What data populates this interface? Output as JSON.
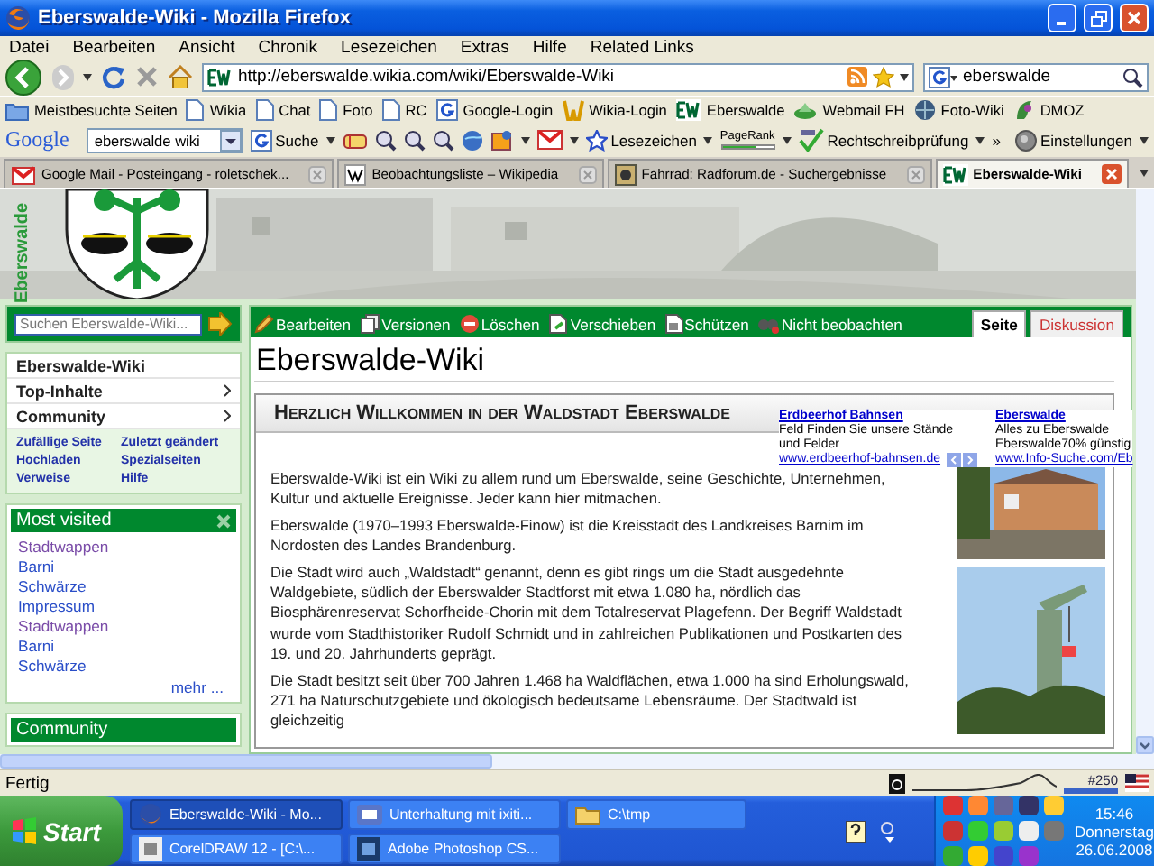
{
  "window": {
    "title": "Eberswalde-Wiki - Mozilla Firefox"
  },
  "menu": [
    "Datei",
    "Bearbeiten",
    "Ansicht",
    "Chronik",
    "Lesezeichen",
    "Extras",
    "Hilfe",
    "Related Links"
  ],
  "navigation": {
    "url": "http://eberswalde.wikia.com/wiki/Eberswalde-Wiki",
    "search": "eberswalde"
  },
  "bookmarks": [
    {
      "label": "Meistbesuchte Seiten",
      "kind": "folder"
    },
    {
      "label": "Wikia",
      "kind": "page"
    },
    {
      "label": "Chat",
      "kind": "page"
    },
    {
      "label": "Foto",
      "kind": "page"
    },
    {
      "label": "RC",
      "kind": "page"
    },
    {
      "label": "Google-Login",
      "kind": "google"
    },
    {
      "label": "Wikia-Login",
      "kind": "wikia"
    },
    {
      "label": "Eberswalde",
      "kind": "ew"
    },
    {
      "label": "Webmail FH",
      "kind": "mail"
    },
    {
      "label": "Foto-Wiki",
      "kind": "globe"
    },
    {
      "label": "DMOZ",
      "kind": "dmoz"
    }
  ],
  "google_toolbar": {
    "logo": "Google",
    "query": "eberswalde wiki",
    "search_button": "Suche",
    "bookmarks_button": "Lesezeichen",
    "pagerank": "PageRank",
    "spellcheck": "Rechtschreibprüfung",
    "more": "»",
    "settings": "Einstellungen"
  },
  "tabs": [
    {
      "label": "Google Mail - Posteingang - roletschek...",
      "kind": "gmail",
      "selected": false
    },
    {
      "label": "Beobachtungsliste – Wikipedia",
      "kind": "wikipedia",
      "selected": false
    },
    {
      "label": "Fahrrad: Radforum.de - Suchergebnisse",
      "kind": "forum",
      "selected": false
    },
    {
      "label": "Eberswalde-Wiki",
      "kind": "ew",
      "selected": true
    }
  ],
  "wiki": {
    "logo_text": "Eberswalde",
    "search": {
      "placeholder": "Suchen Eberswalde-Wiki..."
    },
    "nav": [
      {
        "label": "Eberswalde-Wiki",
        "expandable": false
      },
      {
        "label": "Top-Inhalte",
        "expandable": true
      },
      {
        "label": "Community",
        "expandable": true
      }
    ],
    "quick_links": [
      "Zufällige Seite",
      "Zuletzt geändert",
      "Hochladen",
      "Spezialseiten",
      "Verweise",
      "Hilfe"
    ],
    "most_visited": {
      "title": "Most visited",
      "items": [
        {
          "label": "Stadtwappen",
          "visited": true
        },
        {
          "label": "Barni",
          "visited": false
        },
        {
          "label": "Schwärze",
          "visited": false
        },
        {
          "label": "Impressum",
          "visited": false
        },
        {
          "label": "Stadtwappen",
          "visited": true
        },
        {
          "label": "Barni",
          "visited": false
        },
        {
          "label": "Schwärze",
          "visited": false
        }
      ],
      "more": "mehr ..."
    },
    "community_box": {
      "title": "Community"
    },
    "actions": [
      {
        "label": "Bearbeiten",
        "kind": "edit"
      },
      {
        "label": "Versionen",
        "kind": "history"
      },
      {
        "label": "Löschen",
        "kind": "delete"
      },
      {
        "label": "Verschieben",
        "kind": "move"
      },
      {
        "label": "Schützen",
        "kind": "protect"
      },
      {
        "label": "Nicht beobachten",
        "kind": "unwatch"
      }
    ],
    "page_tabs": [
      {
        "label": "Seite",
        "selected": true
      },
      {
        "label": "Diskussion",
        "selected": false
      }
    ],
    "title": "Eberswalde-Wiki",
    "welcome": {
      "heading": "Herzlich Willkommen in der Waldstadt Eberswalde",
      "paragraphs": [
        "Eberswalde-Wiki ist ein Wiki zu allem rund um Eberswalde, seine Geschichte, Unternehmen, Kultur und aktuelle Ereignisse. Jeder kann hier mitmachen.",
        "Eberswalde (1970–1993 Eberswalde-Finow) ist die Kreisstadt des Landkreises Barnim im Nordosten des Landes Brandenburg.",
        "Die Stadt wird auch „Waldstadt“ genannt, denn es gibt rings um die Stadt ausgedehnte Waldgebiete, südlich der Eberswalder Stadtforst mit etwa 1.080 ha, nördlich das Biosphärenreservat Schorfheide-Chorin mit dem Totalreservat Plagefenn. Der Begriff Waldstadt wurde vom Stadthistoriker Rudolf Schmidt und in zahlreichen Publikationen und Postkarten des 19. und 20. Jahrhunderts geprägt.",
        "Die Stadt besitzt seit über 700 Jahren 1.468 ha Waldflächen, etwa 1.000 ha sind Erholungswald, 271 ha Naturschutzgebiete und ökologisch bedeutsame Lebensräume. Der Stadtwald ist gleichzeitig"
      ]
    },
    "ads": [
      {
        "title": "Erdbeerhof Bahnsen",
        "lines": [
          "Feld Finden Sie unsere Stände",
          "und Felder"
        ],
        "url": "www.erdbeerhof-bahnsen.de"
      },
      {
        "title": "Eberswalde",
        "lines": [
          "Alles zu Eberswalde",
          "Eberswalde70% günstig"
        ],
        "url": "www.Info-Suche.com/Eb"
      }
    ]
  },
  "status_bar": {
    "text": "Fertig",
    "counter": "#250"
  },
  "taskbar": {
    "start": "Start",
    "tasks": [
      {
        "label": "Eberswalde-Wiki - Mo...",
        "kind": "firefox",
        "selected": true
      },
      {
        "label": "Unterhaltung mit ixiti...",
        "kind": "chat",
        "selected": false
      },
      {
        "label": "C:\\tmp",
        "kind": "folder",
        "selected": false
      },
      {
        "label": "CorelDRAW 12 - [C:\\...",
        "kind": "corel",
        "selected": false
      },
      {
        "label": "Adobe Photoshop CS...",
        "kind": "photoshop",
        "selected": false
      }
    ],
    "clock": {
      "time": "15:46",
      "day": "Donnerstag",
      "date": "26.06.2008"
    }
  }
}
